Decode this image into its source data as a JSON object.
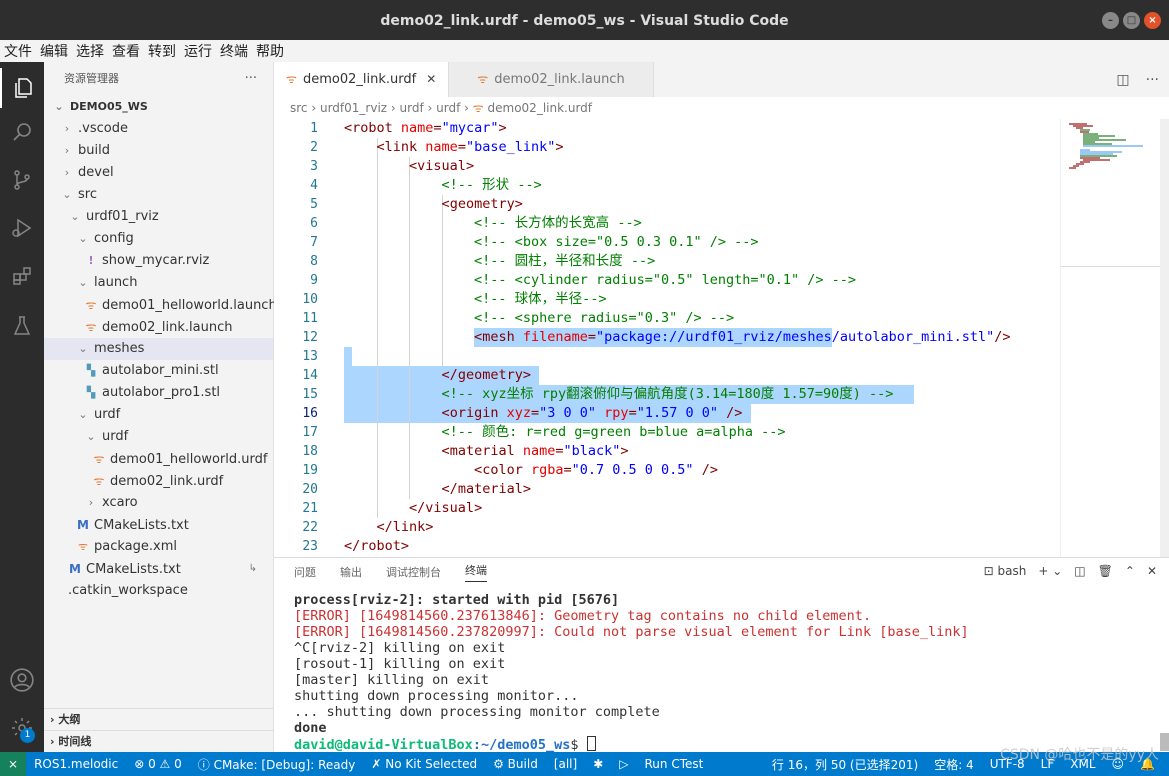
{
  "window": {
    "title": "demo02_link.urdf - demo05_ws - Visual Studio Code"
  },
  "menu": [
    "文件",
    "编辑",
    "选择",
    "查看",
    "转到",
    "运行",
    "终端",
    "帮助"
  ],
  "activity": {
    "accounts_badge": "1"
  },
  "sidebar": {
    "title": "资源管理器",
    "more": "···",
    "tree": [
      {
        "label": "DEMO05_WS",
        "depth": 0,
        "chev": "⌄",
        "icon": "",
        "root": true
      },
      {
        "label": ".vscode",
        "depth": 1,
        "chev": "›",
        "icon": ""
      },
      {
        "label": "build",
        "depth": 1,
        "chev": "›",
        "icon": ""
      },
      {
        "label": "devel",
        "depth": 1,
        "chev": "›",
        "icon": ""
      },
      {
        "label": "src",
        "depth": 1,
        "chev": "⌄",
        "icon": ""
      },
      {
        "label": "urdf01_rviz",
        "depth": 2,
        "chev": "⌄",
        "icon": ""
      },
      {
        "label": "config",
        "depth": 3,
        "chev": "⌄",
        "icon": ""
      },
      {
        "label": "show_mycar.rviz",
        "depth": 4,
        "chev": "",
        "icon": "bang"
      },
      {
        "label": "launch",
        "depth": 3,
        "chev": "⌄",
        "icon": ""
      },
      {
        "label": "demo01_helloworld.launch",
        "depth": 4,
        "chev": "",
        "icon": "rss"
      },
      {
        "label": "demo02_link.launch",
        "depth": 4,
        "chev": "",
        "icon": "rss"
      },
      {
        "label": "meshes",
        "depth": 3,
        "chev": "⌄",
        "icon": "",
        "selected": true
      },
      {
        "label": "autolabor_mini.stl",
        "depth": 4,
        "chev": "",
        "icon": "stl"
      },
      {
        "label": "autolabor_pro1.stl",
        "depth": 4,
        "chev": "",
        "icon": "stl"
      },
      {
        "label": "urdf",
        "depth": 3,
        "chev": "⌄",
        "icon": ""
      },
      {
        "label": "urdf",
        "depth": 4,
        "chev": "⌄",
        "icon": ""
      },
      {
        "label": "demo01_helloworld.urdf",
        "depth": 5,
        "chev": "",
        "icon": "rss"
      },
      {
        "label": "demo02_link.urdf",
        "depth": 5,
        "chev": "",
        "icon": "rss"
      },
      {
        "label": "xcaro",
        "depth": 4,
        "chev": "›",
        "icon": ""
      },
      {
        "label": "CMakeLists.txt",
        "depth": 3,
        "chev": "",
        "icon": "cm"
      },
      {
        "label": "package.xml",
        "depth": 3,
        "chev": "",
        "icon": "xml"
      },
      {
        "label": "CMakeLists.txt",
        "depth": 2,
        "chev": "",
        "icon": "cm",
        "link": true
      },
      {
        "label": ".catkin_workspace",
        "depth": 2,
        "chev": "",
        "icon": ""
      }
    ],
    "outline": "大纲",
    "timeline": "时间线"
  },
  "tabs": [
    {
      "label": "demo02_link.urdf",
      "active": true
    },
    {
      "label": "demo02_link.launch",
      "active": false
    }
  ],
  "breadcrumb": [
    "src",
    "urdf01_rviz",
    "urdf",
    "urdf",
    "demo02_link.urdf"
  ],
  "code": [
    [
      [
        "p",
        "<"
      ],
      [
        "t",
        "robot "
      ],
      [
        "a",
        "name"
      ],
      [
        "p",
        "="
      ],
      [
        "s",
        "\"mycar\""
      ],
      [
        "p",
        ">"
      ]
    ],
    [
      [
        "i",
        "    "
      ],
      [
        "p",
        "<"
      ],
      [
        "t",
        "link "
      ],
      [
        "a",
        "name"
      ],
      [
        "p",
        "="
      ],
      [
        "s",
        "\"base_link\""
      ],
      [
        "p",
        ">"
      ]
    ],
    [
      [
        "i",
        "        "
      ],
      [
        "p",
        "<"
      ],
      [
        "t",
        "visual"
      ],
      [
        "p",
        ">"
      ]
    ],
    [
      [
        "i",
        "            "
      ],
      [
        "c",
        "<!-- 形状 -->"
      ]
    ],
    [
      [
        "i",
        "            "
      ],
      [
        "p",
        "<"
      ],
      [
        "t",
        "geometry"
      ],
      [
        "p",
        ">"
      ]
    ],
    [
      [
        "i",
        "                "
      ],
      [
        "c",
        "<!-- 长方体的长宽高 -->"
      ]
    ],
    [
      [
        "i",
        "                "
      ],
      [
        "c",
        "<!-- <box size=\"0.5 0.3 0.1\" /> -->"
      ]
    ],
    [
      [
        "i",
        "                "
      ],
      [
        "c",
        "<!-- 圆柱，半径和长度 -->"
      ]
    ],
    [
      [
        "i",
        "                "
      ],
      [
        "c",
        "<!-- <cylinder radius=\"0.5\" length=\"0.1\" /> -->"
      ]
    ],
    [
      [
        "i",
        "                "
      ],
      [
        "c",
        "<!-- 球体，半径-->"
      ]
    ],
    [
      [
        "i",
        "                "
      ],
      [
        "c",
        "<!-- <sphere radius=\"0.3\" /> -->"
      ]
    ],
    [
      [
        "i",
        "                "
      ],
      [
        "p",
        "<"
      ],
      [
        "t",
        "mesh "
      ],
      [
        "a",
        "filename"
      ],
      [
        "p",
        "="
      ],
      [
        "s",
        "\"package://urdf01_rviz/meshes/autolabor_mini.stl\""
      ],
      [
        "p",
        "/>"
      ]
    ],
    [],
    [
      [
        "i",
        "            "
      ],
      [
        "p",
        "</"
      ],
      [
        "t",
        "geometry"
      ],
      [
        "p",
        ">"
      ]
    ],
    [
      [
        "i",
        "            "
      ],
      [
        "c",
        "<!-- xyz坐标 rpy翻滚俯仰与偏航角度(3.14=180度 1.57=90度) -->"
      ]
    ],
    [
      [
        "i",
        "            "
      ],
      [
        "p",
        "<"
      ],
      [
        "t",
        "origin "
      ],
      [
        "a",
        "xyz"
      ],
      [
        "p",
        "="
      ],
      [
        "s",
        "\"3 0 0\""
      ],
      [
        "t",
        " "
      ],
      [
        "a",
        "rpy"
      ],
      [
        "p",
        "="
      ],
      [
        "s",
        "\"1.57 0 0\""
      ],
      [
        "t",
        " "
      ],
      [
        "p",
        "/>"
      ]
    ],
    [
      [
        "i",
        "            "
      ],
      [
        "c",
        "<!-- 颜色: r=red g=green b=blue a=alpha -->"
      ]
    ],
    [
      [
        "i",
        "            "
      ],
      [
        "p",
        "<"
      ],
      [
        "t",
        "material "
      ],
      [
        "a",
        "name"
      ],
      [
        "p",
        "="
      ],
      [
        "s",
        "\"black\""
      ],
      [
        "p",
        ">"
      ]
    ],
    [
      [
        "i",
        "                "
      ],
      [
        "p",
        "<"
      ],
      [
        "t",
        "color "
      ],
      [
        "a",
        "rgba"
      ],
      [
        "p",
        "="
      ],
      [
        "s",
        "\"0.7 0.5 0 0.5\""
      ],
      [
        "t",
        " "
      ],
      [
        "p",
        "/>"
      ]
    ],
    [
      [
        "i",
        "            "
      ],
      [
        "p",
        "</"
      ],
      [
        "t",
        "material"
      ],
      [
        "p",
        ">"
      ]
    ],
    [
      [
        "i",
        "        "
      ],
      [
        "p",
        "</"
      ],
      [
        "t",
        "visual"
      ],
      [
        "p",
        ">"
      ]
    ],
    [
      [
        "i",
        "    "
      ],
      [
        "p",
        "</"
      ],
      [
        "t",
        "link"
      ],
      [
        "p",
        ">"
      ]
    ],
    [
      [
        "p",
        "</"
      ],
      [
        "t",
        "robot"
      ],
      [
        "p",
        ">"
      ]
    ]
  ],
  "line_numbers": [
    "1",
    "2",
    "3",
    "4",
    "5",
    "6",
    "7",
    "8",
    "9",
    "10",
    "11",
    "12",
    "13",
    "14",
    "15",
    "16",
    "17",
    "18",
    "19",
    "20",
    "21",
    "22",
    "23"
  ],
  "current_line": 16,
  "panel": {
    "tabs": [
      "问题",
      "输出",
      "调试控制台",
      "终端"
    ],
    "active_tab": "终端",
    "shell": "bash",
    "terminal": [
      {
        "text": "process[rviz-2]: started with pid [5676]",
        "kind": "bold"
      },
      {
        "text": "[ERROR] [1649814560.237613846]: Geometry tag contains no child element.",
        "kind": "err"
      },
      {
        "text": "[ERROR] [1649814560.237820997]: Could not parse visual element for Link [base_link]",
        "kind": "err"
      },
      {
        "text": "^C[rviz-2] killing on exit",
        "kind": ""
      },
      {
        "text": "[rosout-1] killing on exit",
        "kind": ""
      },
      {
        "text": "[master] killing on exit",
        "kind": ""
      },
      {
        "text": "shutting down processing monitor...",
        "kind": ""
      },
      {
        "text": "... shutting down processing monitor complete",
        "kind": ""
      },
      {
        "text": "done",
        "kind": "bold"
      }
    ],
    "prompt_user": "david@david-VirtualBox",
    "prompt_path": ":~/demo05_ws",
    "prompt_end": "$ "
  },
  "status": {
    "remote": "⨯",
    "ros": "ROS1.melodic",
    "problems": "⊗ 0 ⚠ 0",
    "cmake": "ⓘ CMake: [Debug]: Ready",
    "kit": "✗ No Kit Selected",
    "build": "⚙ Build",
    "all": "[all]",
    "debug": "✱",
    "run": "▷",
    "ctest": "Run CTest",
    "position": "行 16，列 50 (已选择201)",
    "spaces": "空格: 4",
    "encoding": "UTF-8",
    "eol": "LF",
    "lang": "XML",
    "feedback": "☺",
    "bell": "🔔"
  },
  "watermark": "CSDN @哈也不是的yy人"
}
